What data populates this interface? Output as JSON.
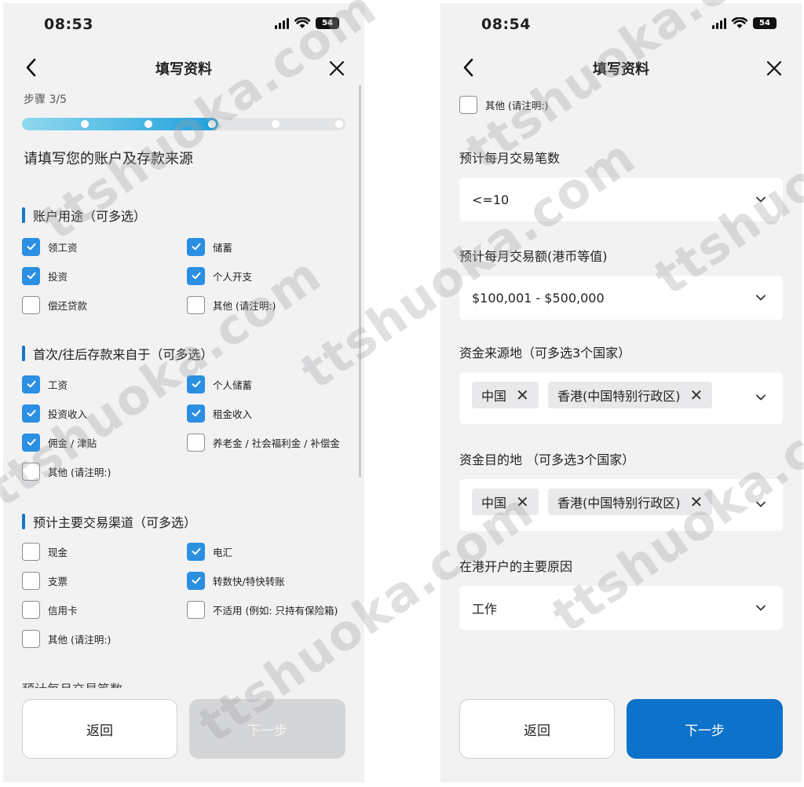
{
  "left": {
    "status": {
      "time": "08:53",
      "battery": "54"
    },
    "nav": {
      "title": "填写资料"
    },
    "step": {
      "label": "步骤 3/5",
      "current": 3,
      "total": 5
    },
    "heading": "请填写您的账户及存款来源",
    "sections": [
      {
        "title": "账户用途（可多选）",
        "options": [
          {
            "label": "领工资",
            "checked": true
          },
          {
            "label": "储蓄",
            "checked": true
          },
          {
            "label": "投资",
            "checked": true
          },
          {
            "label": "个人开支",
            "checked": true
          },
          {
            "label": "偿还贷款",
            "checked": false
          },
          {
            "label": "其他 (请注明:)",
            "checked": false
          }
        ]
      },
      {
        "title": "首次/往后存款来自于（可多选）",
        "options": [
          {
            "label": "工资",
            "checked": true
          },
          {
            "label": "个人储蓄",
            "checked": true
          },
          {
            "label": "投资收入",
            "checked": true
          },
          {
            "label": "租金收入",
            "checked": true
          },
          {
            "label": "佣金 / 津贴",
            "checked": true
          },
          {
            "label": "养老金 / 社会福利金 / 补偿金",
            "checked": false
          },
          {
            "label": "其他 (请注明:)",
            "checked": false
          }
        ]
      },
      {
        "title": "预计主要交易渠道（可多选）",
        "options": [
          {
            "label": "现金",
            "checked": false
          },
          {
            "label": "电汇",
            "checked": true
          },
          {
            "label": "支票",
            "checked": false
          },
          {
            "label": "转数快/特快转账",
            "checked": true
          },
          {
            "label": "信用卡",
            "checked": false
          },
          {
            "label": "不适用 (例如: 只持有保险箱)",
            "checked": false
          },
          {
            "label": "其他 (请注明:)",
            "checked": false
          }
        ]
      }
    ],
    "partial_label": "预计每月交易笔数",
    "footer": {
      "back": "返回",
      "next": "下一步",
      "next_enabled": false
    }
  },
  "right": {
    "status": {
      "time": "08:54",
      "battery": "54"
    },
    "nav": {
      "title": "填写资料"
    },
    "other_option": {
      "label": "其他 (请注明:)",
      "checked": false
    },
    "fields": {
      "monthly_count": {
        "label": "预计每月交易笔数",
        "value": "<=10"
      },
      "monthly_amount": {
        "label": "预计每月交易额(港币等值)",
        "value": "$100,001 - $500,000"
      },
      "fund_source": {
        "label": "资金来源地（可多选3个国家）",
        "chips": [
          "中国",
          "香港(中国特别行政区)"
        ]
      },
      "fund_destination": {
        "label": "资金目的地 （可多选3个国家）",
        "chips": [
          "中国",
          "香港(中国特别行政区)"
        ]
      },
      "main_reason": {
        "label": "在港开户的主要原因",
        "value": "工作"
      }
    },
    "footer": {
      "back": "返回",
      "next": "下一步",
      "next_enabled": true
    }
  },
  "watermark_text": "ttshuoka.com",
  "colors": {
    "accent": "#0d72c9",
    "checkbox": "#2b8fe2",
    "section_bar": "#1976c8",
    "progress_end": "#1ea0dd"
  }
}
